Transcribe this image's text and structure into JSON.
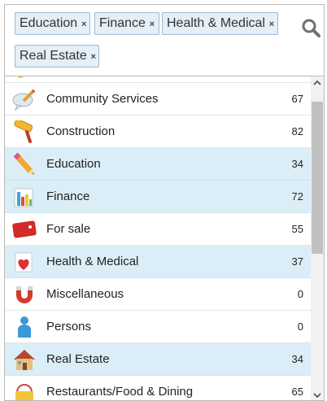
{
  "selected_tags": [
    {
      "label": "Education",
      "remove": "×"
    },
    {
      "label": "Finance",
      "remove": "×"
    },
    {
      "label": "Health & Medical",
      "remove": "×"
    },
    {
      "label": "Real Estate",
      "remove": "×"
    }
  ],
  "search": {
    "icon": "search-icon"
  },
  "categories": [
    {
      "label": "Community Services",
      "count": "67",
      "icon": "speech-bubble-pencil-icon",
      "selected": false
    },
    {
      "label": "Construction",
      "count": "82",
      "icon": "paint-roller-icon",
      "selected": false
    },
    {
      "label": "Education",
      "count": "34",
      "icon": "pencil-icon",
      "selected": true
    },
    {
      "label": "Finance",
      "count": "72",
      "icon": "bar-chart-icon",
      "selected": true
    },
    {
      "label": "For sale",
      "count": "55",
      "icon": "price-tag-icon",
      "selected": false
    },
    {
      "label": "Health & Medical",
      "count": "37",
      "icon": "heart-icon",
      "selected": true
    },
    {
      "label": "Miscellaneous",
      "count": "0",
      "icon": "magnet-icon",
      "selected": false
    },
    {
      "label": "Persons",
      "count": "0",
      "icon": "person-icon",
      "selected": false
    },
    {
      "label": "Real Estate",
      "count": "34",
      "icon": "house-icon",
      "selected": true
    },
    {
      "label": "Restaurants/Food & Dining",
      "count": "65",
      "icon": "shopping-basket-icon",
      "selected": false
    }
  ],
  "colors": {
    "selected_row": "#dbeef7",
    "tag_bg": "#e4eff7",
    "tag_border": "#9ab9d3"
  }
}
